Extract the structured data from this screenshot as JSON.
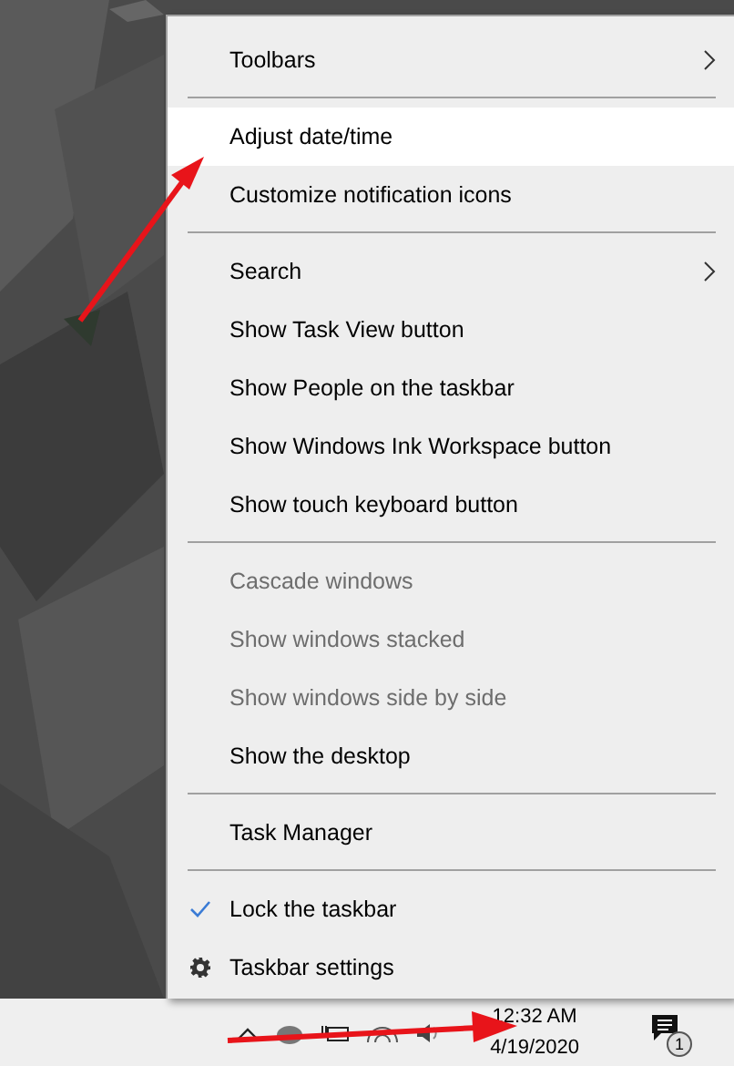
{
  "context_menu": {
    "items": [
      {
        "kind": "item",
        "label": "Toolbars",
        "submenu": true,
        "disabled": false,
        "selected": false
      },
      {
        "kind": "separator"
      },
      {
        "kind": "item",
        "label": "Adjust date/time",
        "submenu": false,
        "disabled": false,
        "selected": true
      },
      {
        "kind": "item",
        "label": "Customize notification icons",
        "submenu": false,
        "disabled": false,
        "selected": false
      },
      {
        "kind": "separator"
      },
      {
        "kind": "item",
        "label": "Search",
        "submenu": true,
        "disabled": false,
        "selected": false
      },
      {
        "kind": "item",
        "label": "Show Task View button",
        "submenu": false,
        "disabled": false,
        "selected": false
      },
      {
        "kind": "item",
        "label": "Show People on the taskbar",
        "submenu": false,
        "disabled": false,
        "selected": false
      },
      {
        "kind": "item",
        "label": "Show Windows Ink Workspace button",
        "submenu": false,
        "disabled": false,
        "selected": false
      },
      {
        "kind": "item",
        "label": "Show touch keyboard button",
        "submenu": false,
        "disabled": false,
        "selected": false
      },
      {
        "kind": "separator"
      },
      {
        "kind": "item",
        "label": "Cascade windows",
        "submenu": false,
        "disabled": true,
        "selected": false
      },
      {
        "kind": "item",
        "label": "Show windows stacked",
        "submenu": false,
        "disabled": true,
        "selected": false
      },
      {
        "kind": "item",
        "label": "Show windows side by side",
        "submenu": false,
        "disabled": true,
        "selected": false
      },
      {
        "kind": "item",
        "label": "Show the desktop",
        "submenu": false,
        "disabled": false,
        "selected": false
      },
      {
        "kind": "separator"
      },
      {
        "kind": "item",
        "label": "Task Manager",
        "submenu": false,
        "disabled": false,
        "selected": false
      },
      {
        "kind": "separator"
      },
      {
        "kind": "toggle",
        "label": "Lock the taskbar",
        "checked": true,
        "disabled": false,
        "selected": false
      },
      {
        "kind": "settings",
        "label": "Taskbar settings",
        "disabled": false,
        "selected": false
      }
    ]
  },
  "taskbar": {
    "clock": {
      "time": "12:32 AM",
      "date": "4/19/2020"
    },
    "notifications": {
      "badge": "1"
    }
  }
}
